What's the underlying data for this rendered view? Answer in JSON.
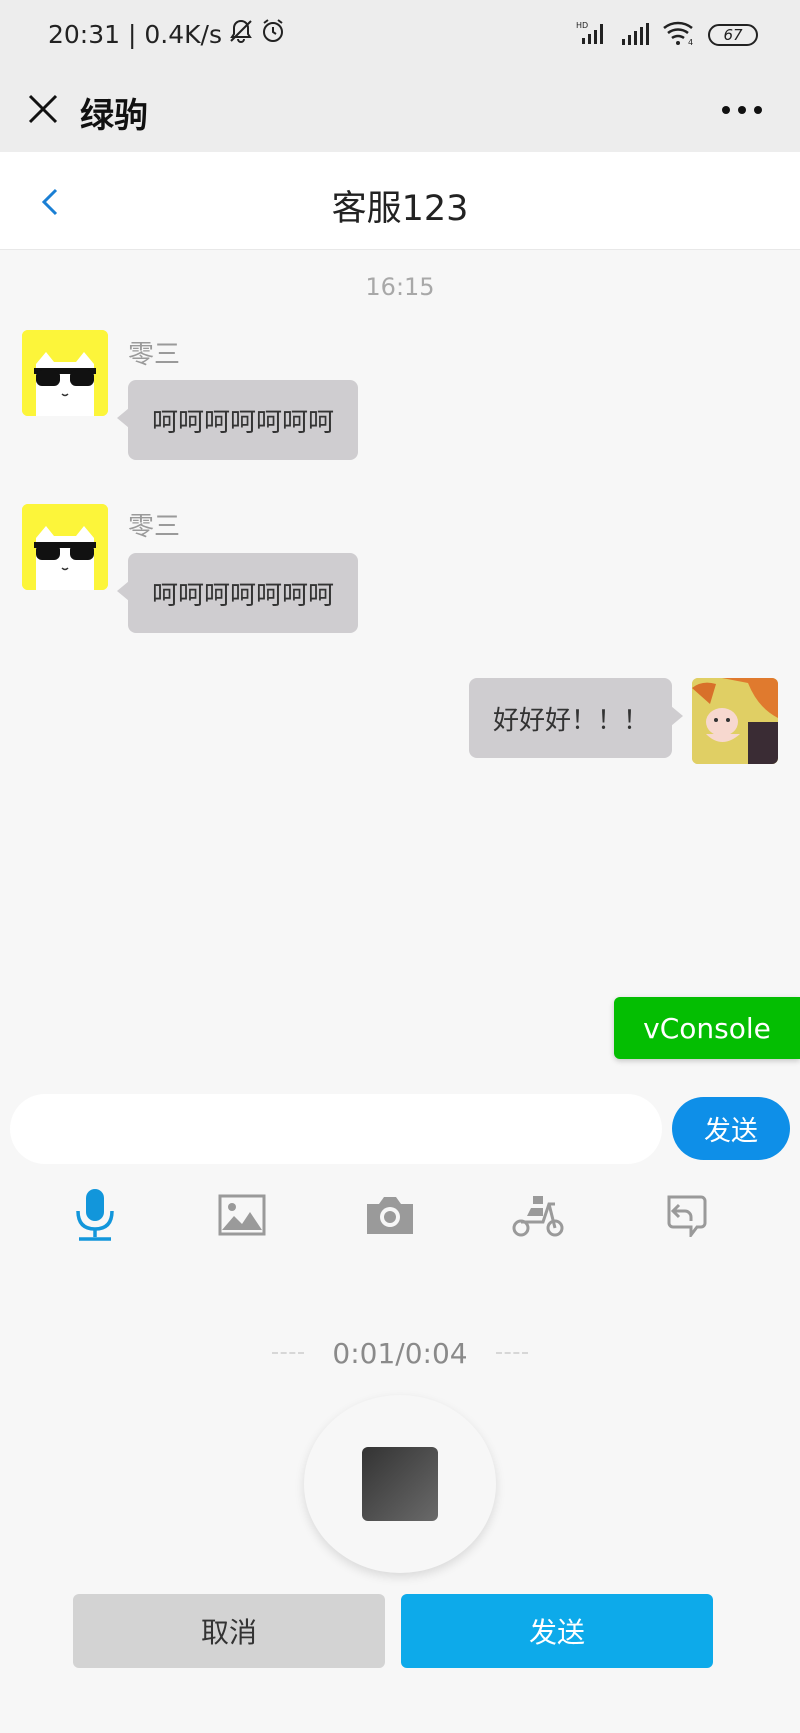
{
  "status_bar": {
    "time_speed": "20:31 | 0.4K/s",
    "battery": "67"
  },
  "wechat_header": {
    "title": "绿驹"
  },
  "chat": {
    "title": "客服123",
    "timestamp": "16:15",
    "messages": [
      {
        "sender": "零三",
        "text": "呵呵呵呵呵呵呵",
        "side": "left"
      },
      {
        "sender": "零三",
        "text": "呵呵呵呵呵呵呵",
        "side": "left"
      },
      {
        "text": "好好好！！！",
        "side": "right"
      }
    ]
  },
  "vconsole": {
    "label": "vConsole"
  },
  "input": {
    "value": "",
    "send_label": "发送"
  },
  "toolbar": {
    "items": [
      "mic-icon",
      "image-icon",
      "camera-icon",
      "scooter-icon",
      "undo-icon"
    ],
    "active_color": "#1296db",
    "inactive_color": "#9a9a9a"
  },
  "recorder": {
    "time": "0:01/0:04",
    "cancel_label": "取消",
    "send_label": "发送"
  }
}
